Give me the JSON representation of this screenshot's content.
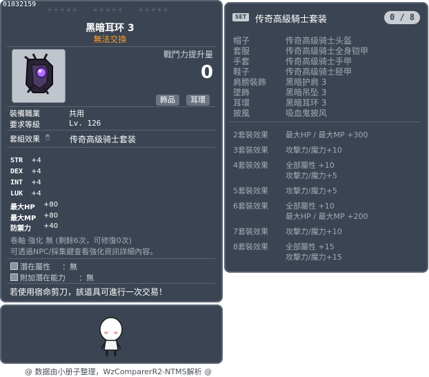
{
  "item": {
    "code": "01032159",
    "name": "黑暗耳环  3",
    "untradeable": "無法交換",
    "power_label": "戰鬥力提升量",
    "power_value": "0",
    "tags": [
      "飾品",
      "耳環"
    ],
    "requirements": [
      {
        "label": "裝備職業",
        "value": "共用"
      },
      {
        "label": "要求等級",
        "value": "Lv. 126"
      }
    ],
    "set_effect_label": "套組效果",
    "set_effect_name": "传奇高级骑士套装",
    "stats": [
      {
        "name": "STR",
        "value": "+4"
      },
      {
        "name": "DEX",
        "value": "+4"
      },
      {
        "name": "INT",
        "value": "+4"
      },
      {
        "name": "LUK",
        "value": "+4"
      },
      {
        "name": "最大HP",
        "value": "+80"
      },
      {
        "name": "最大MP",
        "value": "+80"
      },
      {
        "name": "防禦力",
        "value": "+40"
      }
    ],
    "upgrade_line": "卷軸 強化 無 (剩餘6次，可修復0次)",
    "upgrade_note": "可透過NPC/採集鍵查看強化資訊詳細內容。",
    "potentials": [
      {
        "label": "潛在屬性",
        "value": "：無"
      },
      {
        "label": "附加潛在能力",
        "value": "：無"
      }
    ],
    "scissors_note": "若使用宿命剪刀，該道具可進行一次交易！",
    "colors": {
      "panel": "#3a4452",
      "border": "#5b6674",
      "untradeable": "#ff9c2a",
      "dim_text": "#a3aab3"
    }
  },
  "set": {
    "badge": "SET",
    "title": "传奇高級騎士套装",
    "count": "0 / 8",
    "parts": [
      {
        "slot": "帽子",
        "item": "传奇高级骑士头盔"
      },
      {
        "slot": "套服",
        "item": "传奇高级骑士全身铠甲"
      },
      {
        "slot": "手套",
        "item": "传奇高级骑士手甲"
      },
      {
        "slot": "鞋子",
        "item": "传奇高级骑士胫甲"
      },
      {
        "slot": "肩膀裝飾",
        "item": "黑暗护肩  3"
      },
      {
        "slot": "墜飾",
        "item": "黑暗吊坠  3"
      },
      {
        "slot": "耳環",
        "item": "黑暗耳环  3"
      },
      {
        "slot": "披風",
        "item": "吸血鬼披风"
      }
    ],
    "effects": [
      {
        "label": "2套裝效果",
        "lines": [
          "最大HP / 最大MP   +300"
        ]
      },
      {
        "label": "3套裝效果",
        "lines": [
          "攻擊力/魔力+10"
        ]
      },
      {
        "label": "4套裝效果",
        "lines": [
          "全部屬性  +10",
          "攻擊力/魔力+5"
        ]
      },
      {
        "label": "5套裝效果",
        "lines": [
          "攻擊力/魔力+5"
        ]
      },
      {
        "label": "6套裝效果",
        "lines": [
          "全部屬性  +10",
          "最大HP / 最大MP   +200"
        ]
      },
      {
        "label": "7套裝效果",
        "lines": [
          "攻擊力/魔力+10"
        ]
      },
      {
        "label": "8套裝效果",
        "lines": [
          "全部屬性  +15",
          "攻擊力/魔力+15"
        ]
      }
    ]
  },
  "footer": "@ 数据由小册子整理，WzComparerR2-NTMS解析 @"
}
